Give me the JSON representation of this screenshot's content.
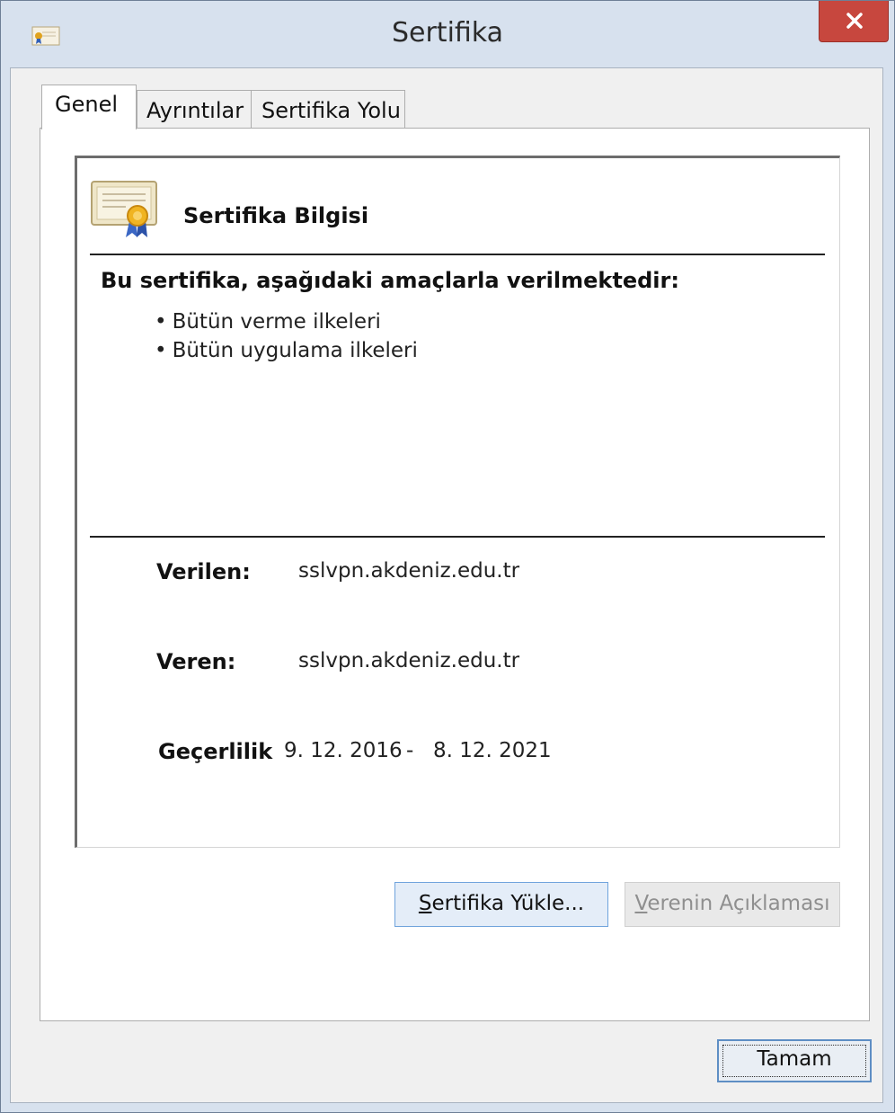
{
  "window": {
    "title": "Sertifika",
    "close_label": "✕"
  },
  "tabs": [
    {
      "label": "Genel",
      "selected": true
    },
    {
      "label": "Ayrıntılar",
      "selected": false
    },
    {
      "label": "Sertifika Yolu",
      "selected": false
    }
  ],
  "general": {
    "info_title": "Sertifika Bilgisi",
    "purpose_heading": "Bu sertifika, aşağıdaki amaçlarla verilmektedir:",
    "purposes": [
      "Bütün verme ilkeleri",
      "Bütün uygulama ilkeleri"
    ],
    "issued_to_label": "Verilen:",
    "issued_to_value": "sslvpn.akdeniz.edu.tr",
    "issued_by_label": "Veren:",
    "issued_by_value": "sslvpn.akdeniz.edu.tr",
    "validity_label": "Geçerlilik",
    "validity_from": "9. 12. 2016",
    "validity_sep": "-",
    "validity_to": "8. 12. 2021"
  },
  "buttons": {
    "install_first": "S",
    "install_rest": "ertifika Yükle...",
    "issuer_first": "V",
    "issuer_rest": "erenin Açıklaması",
    "issuer_enabled": false,
    "ok": "Tamam"
  },
  "icons": {
    "app": "certificate-icon",
    "close": "close-icon",
    "info": "certificate-ribbon-icon"
  },
  "colors": {
    "frame": "#d7e1ee",
    "close_button": "#c7473e",
    "focused_button_border": "#6fa3dc"
  }
}
